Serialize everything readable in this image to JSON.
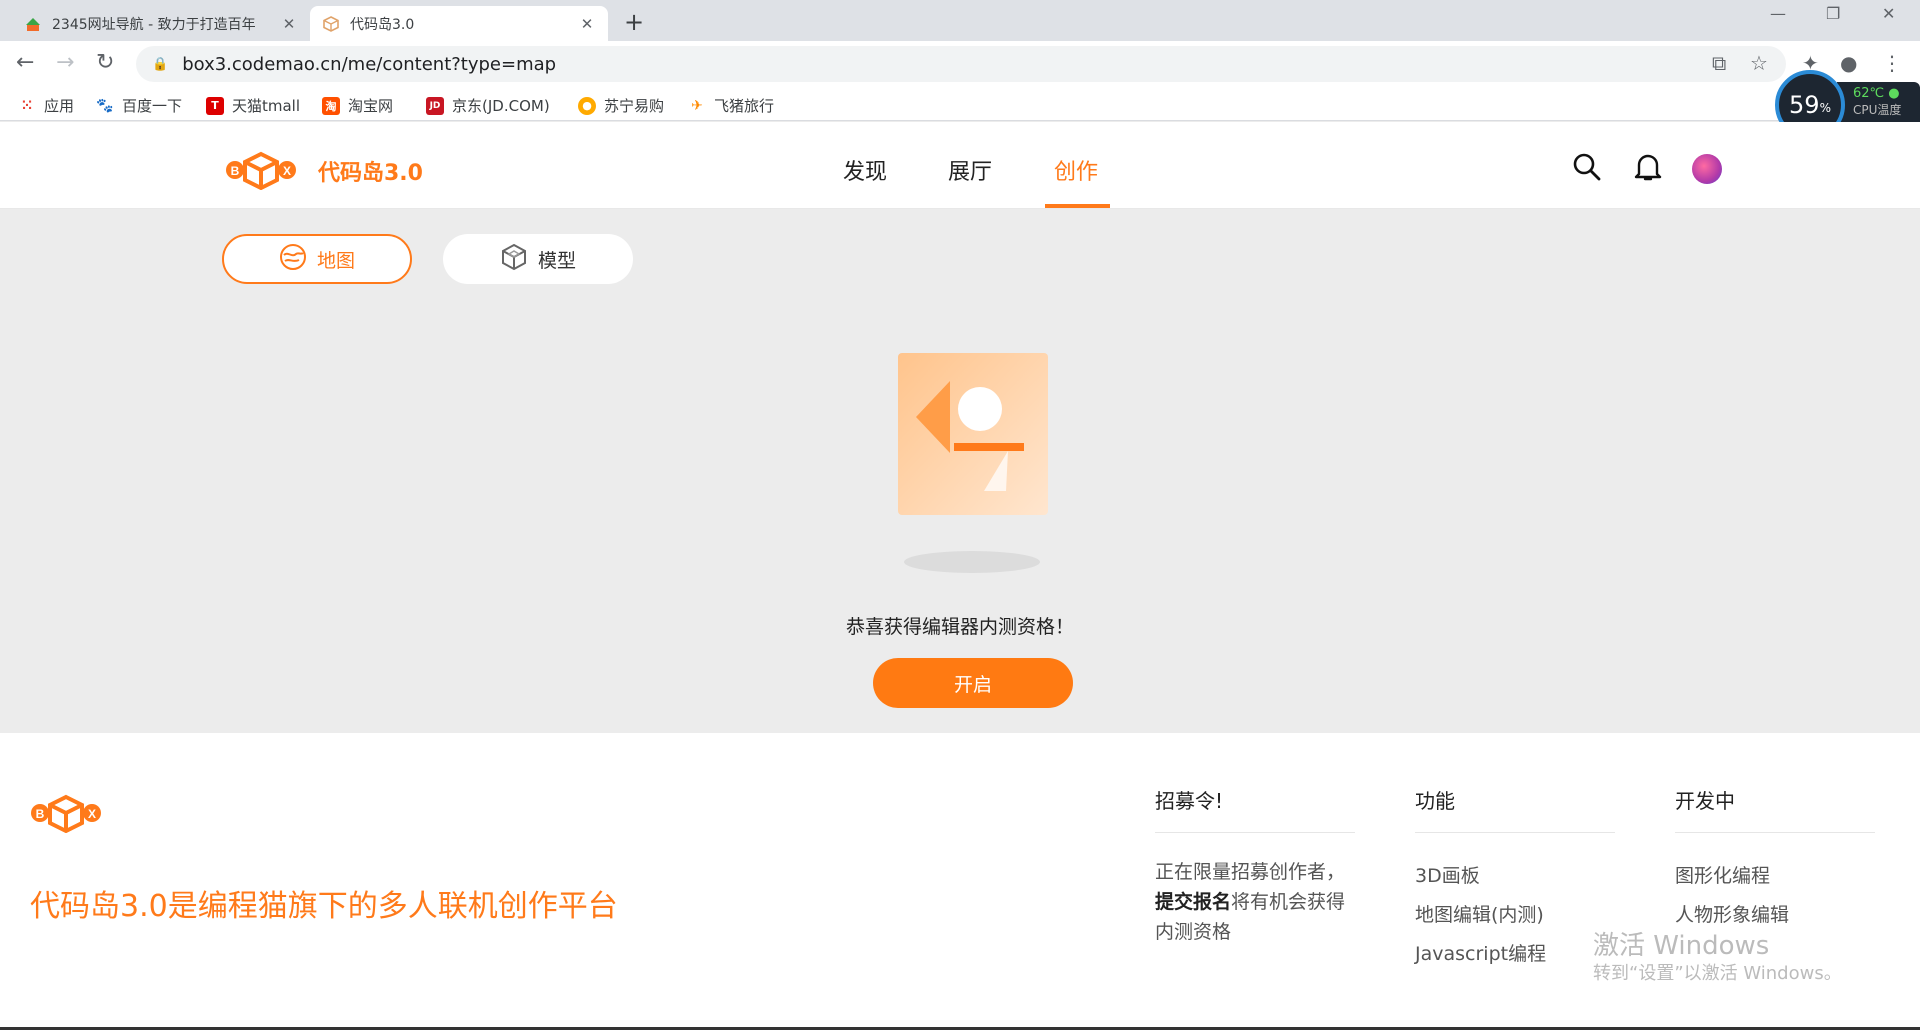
{
  "browser": {
    "tabs": [
      {
        "title": "2345网址导航 - 致力于打造百年",
        "close": "✕"
      },
      {
        "title": "代码岛3.0",
        "close": "✕"
      }
    ],
    "new_tab": "+",
    "url": "box3.codemao.cn/me/content?type=map",
    "bookmarks": [
      {
        "label": "应用",
        "icon": "apps-icon"
      },
      {
        "label": "百度一下",
        "icon": "baidu-icon"
      },
      {
        "label": "天猫tmall",
        "icon": "tmall-icon"
      },
      {
        "label": "淘宝网",
        "icon": "taobao-icon"
      },
      {
        "label": "京东(JD.COM)",
        "icon": "jd-icon"
      },
      {
        "label": "苏宁易购",
        "icon": "suning-icon"
      },
      {
        "label": "飞猪旅行",
        "icon": "fliggy-icon"
      }
    ]
  },
  "cpu_widget": {
    "percent": "59",
    "unit": "%",
    "temp": "62℃",
    "label": "CPU温度"
  },
  "site": {
    "brand": "代码岛3.0",
    "nav": [
      "发现",
      "展厅",
      "创作"
    ],
    "active_nav": "创作"
  },
  "main": {
    "tabs": [
      {
        "label": "地图",
        "active": true
      },
      {
        "label": "模型",
        "active": false
      }
    ],
    "message": "恭喜获得编辑器内测资格！",
    "start_button": "开启"
  },
  "footer": {
    "tagline": "代码岛3.0是编程猫旗下的多人联机创作平台",
    "columns": [
      {
        "heading": "招募令!",
        "para_pre": "正在限量招募创作者，",
        "para_bold": "提交报名",
        "para_post": "将有机会获得内测资格"
      },
      {
        "heading": "功能",
        "items": [
          "3D画板",
          "地图编辑(内测)",
          "Javascript编程"
        ]
      },
      {
        "heading": "开发中",
        "items": [
          "图形化编程",
          "人物形象编辑"
        ]
      }
    ],
    "watermark_title": "激活 Windows",
    "watermark_sub": "转到“设置”以激活 Windows。"
  },
  "colors": {
    "accent": "#ff7a1a",
    "page_bg": "#ececec"
  }
}
